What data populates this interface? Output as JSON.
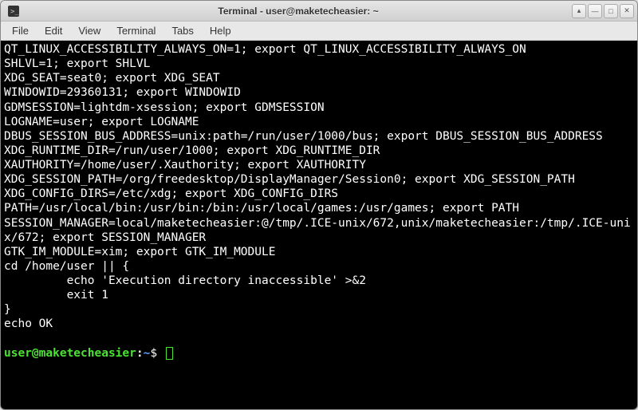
{
  "window": {
    "title": "Terminal - user@maketecheasier: ~"
  },
  "menu": {
    "items": [
      "File",
      "Edit",
      "View",
      "Terminal",
      "Tabs",
      "Help"
    ]
  },
  "terminal": {
    "lines": [
      "QT_LINUX_ACCESSIBILITY_ALWAYS_ON=1; export QT_LINUX_ACCESSIBILITY_ALWAYS_ON",
      "SHLVL=1; export SHLVL",
      "XDG_SEAT=seat0; export XDG_SEAT",
      "WINDOWID=29360131; export WINDOWID",
      "GDMSESSION=lightdm-xsession; export GDMSESSION",
      "LOGNAME=user; export LOGNAME",
      "DBUS_SESSION_BUS_ADDRESS=unix:path=/run/user/1000/bus; export DBUS_SESSION_BUS_ADDRESS",
      "XDG_RUNTIME_DIR=/run/user/1000; export XDG_RUNTIME_DIR",
      "XAUTHORITY=/home/user/.Xauthority; export XAUTHORITY",
      "XDG_SESSION_PATH=/org/freedesktop/DisplayManager/Session0; export XDG_SESSION_PATH",
      "XDG_CONFIG_DIRS=/etc/xdg; export XDG_CONFIG_DIRS",
      "PATH=/usr/local/bin:/usr/bin:/bin:/usr/local/games:/usr/games; export PATH",
      "SESSION_MANAGER=local/maketecheasier:@/tmp/.ICE-unix/672,unix/maketecheasier:/tmp/.ICE-unix/672; export SESSION_MANAGER",
      "GTK_IM_MODULE=xim; export GTK_IM_MODULE",
      "cd /home/user || {",
      "         echo 'Execution directory inaccessible' >&2",
      "         exit 1",
      "}",
      "echo OK",
      ""
    ],
    "prompt": {
      "user_host": "user@maketecheasier",
      "separator": ":",
      "path": "~",
      "symbol": "$"
    }
  },
  "icons": {
    "terminal": "terminal-icon",
    "up": "▴",
    "min": "—",
    "max": "□",
    "close": "✕"
  }
}
